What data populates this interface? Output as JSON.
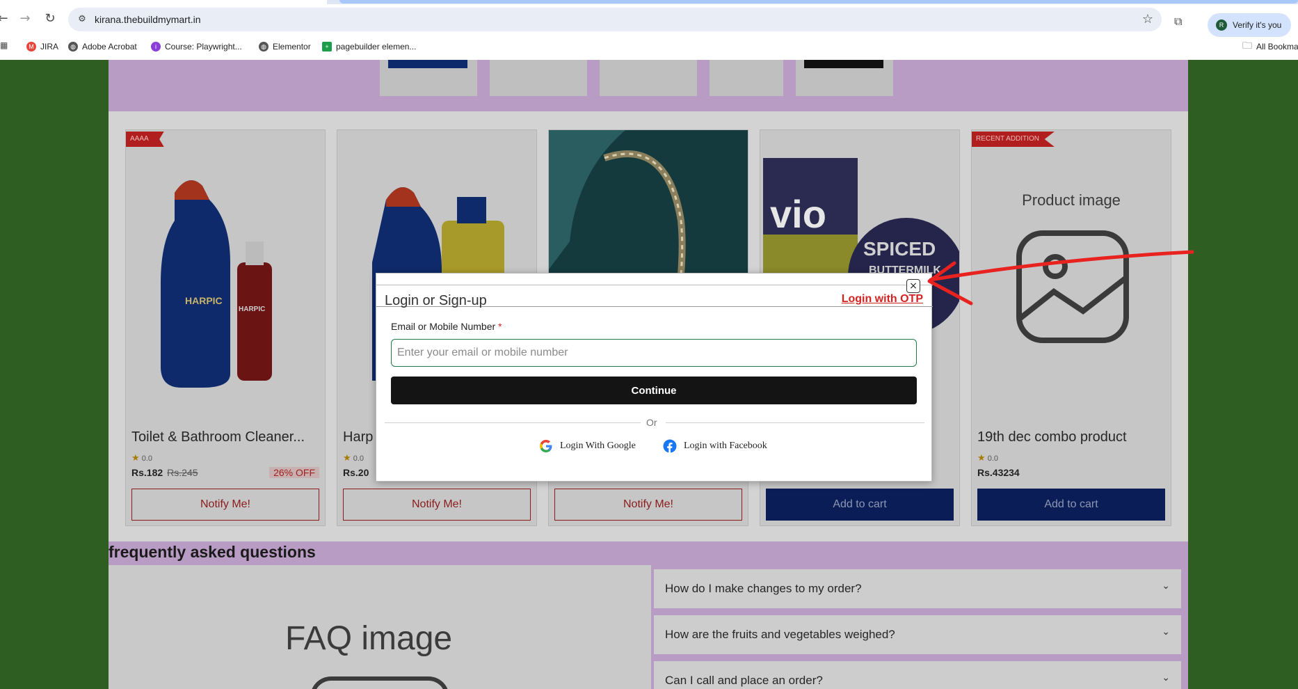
{
  "browser": {
    "url": "kirana.thebuildmymart.in",
    "verify_label": "Verify it's you",
    "avatar_letter": "R",
    "bookmarks": [
      {
        "label": "JIRA",
        "color": "#e8453c"
      },
      {
        "label": "Adobe Acrobat",
        "color": "#555555"
      },
      {
        "label": "Course: Playwright...",
        "color": "#8b3fd9"
      },
      {
        "label": "Elementor",
        "color": "#555555"
      },
      {
        "label": "pagebuilder elemen...",
        "color": "#1e9e4a"
      }
    ],
    "all_bookmarks": "All Bookma"
  },
  "products": [
    {
      "ribbon": "AAAA",
      "title": "Toilet & Bathroom Cleaner...",
      "rating": "0.0",
      "price": "Rs.182",
      "old_price": "Rs.245",
      "off": "26% OFF",
      "button": "Notify Me!"
    },
    {
      "ribbon": "",
      "title": "Harp",
      "rating": "0.0",
      "price": "Rs.20",
      "old_price": "",
      "off": "",
      "button": "Notify Me!"
    },
    {
      "ribbon": "",
      "title": "",
      "rating": "",
      "price": "",
      "old_price": "",
      "off": "",
      "button": "Notify Me!"
    },
    {
      "ribbon": "",
      "title": "",
      "rating": "",
      "price": "",
      "old_price": "",
      "off": "",
      "button": "Add to cart"
    },
    {
      "ribbon": "RECENT ADDITION",
      "title": "19th dec combo product",
      "rating": "0.0",
      "price": "Rs.43234",
      "old_price": "",
      "off": "",
      "button": "Add to cart",
      "placeholder": "Product image"
    }
  ],
  "faq": {
    "title": "frequently asked questions",
    "image_placeholder": "FAQ image",
    "questions": [
      "How do I make changes to my order?",
      "How are the fruits and vegetables weighed?",
      "Can I call and place an order?"
    ]
  },
  "modal": {
    "title": "Login or Sign-up",
    "otp_link": "Login with OTP",
    "close": "×",
    "field_label": "Email or Mobile Number",
    "required_mark": "*",
    "placeholder": "Enter your email or mobile number",
    "continue": "Continue",
    "or": "Or",
    "google": "Login With Google",
    "facebook": "Login with Facebook"
  },
  "colors": {
    "annotation": "#e8231f",
    "continue_bg": "#141414",
    "otp_link": "#d42222",
    "input_border": "#1f7a4a"
  }
}
